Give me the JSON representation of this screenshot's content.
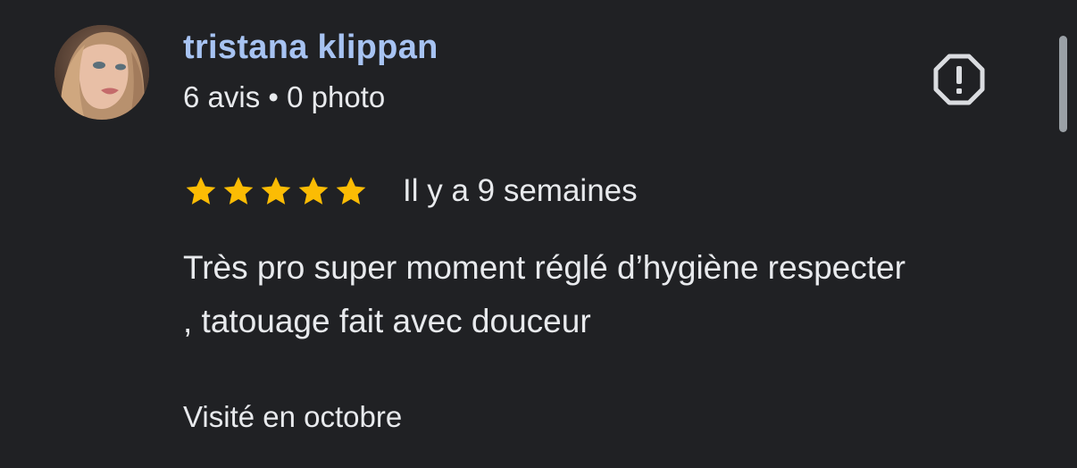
{
  "review": {
    "author": {
      "name": "tristana klippan",
      "reviews_count": "6 avis",
      "separator": "•",
      "photos_count": "0 photo"
    },
    "rating": {
      "stars": 5,
      "max_stars": 5,
      "star_color": "#fbbc04"
    },
    "date": "Il y a 9 semaines",
    "text_lines": [
      "Très pro super moment réglé d’hygiène respecter",
      ", tatouage fait avec douceur"
    ],
    "visited": "Visité en octobre",
    "report_icon": "report-flag-octagon-exclamation-icon"
  },
  "theme": {
    "background": "#202124",
    "author_color": "#a7c3f2",
    "text_color": "#e8eaed",
    "icon_color": "#dadce0"
  }
}
